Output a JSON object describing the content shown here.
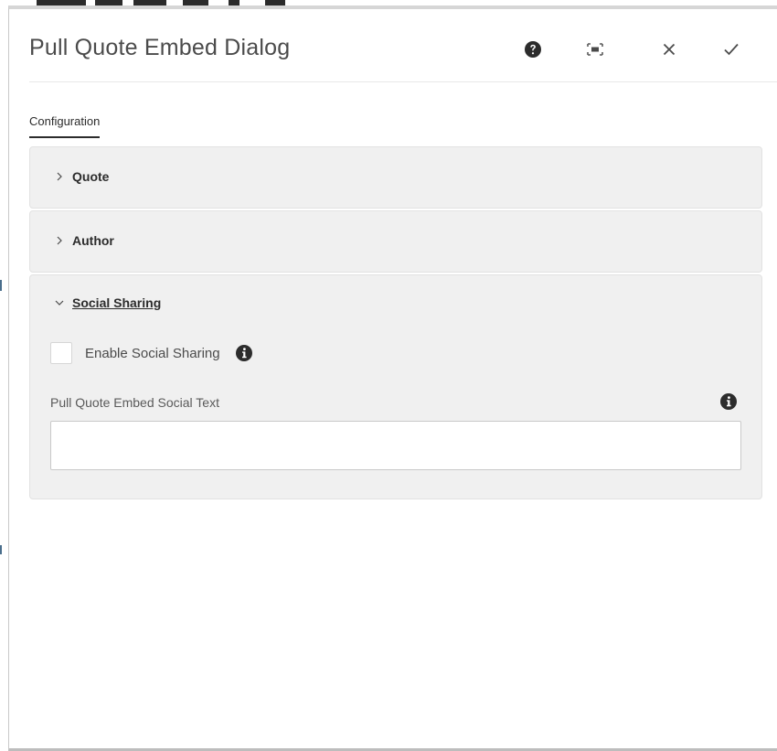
{
  "dialog": {
    "title": "Pull Quote Embed Dialog",
    "header_icons": [
      "help-icon",
      "fullscreen-icon",
      "close-icon",
      "checkmark-icon"
    ]
  },
  "tabs": [
    {
      "label": "Configuration",
      "active": true
    }
  ],
  "sections": {
    "quote": {
      "label": "Quote",
      "expanded": false
    },
    "author": {
      "label": "Author",
      "expanded": false
    },
    "social_sharing": {
      "label": "Social Sharing",
      "expanded": true,
      "checkbox_label": "Enable Social Sharing",
      "checkbox_checked": false,
      "field_label": "Pull Quote Embed Social Text",
      "field_value": "",
      "field_placeholder": ""
    }
  },
  "colors": {
    "panel_bg": "#f0f0f0",
    "text": "#2c2c2c",
    "icon": "#2c2c2c"
  }
}
